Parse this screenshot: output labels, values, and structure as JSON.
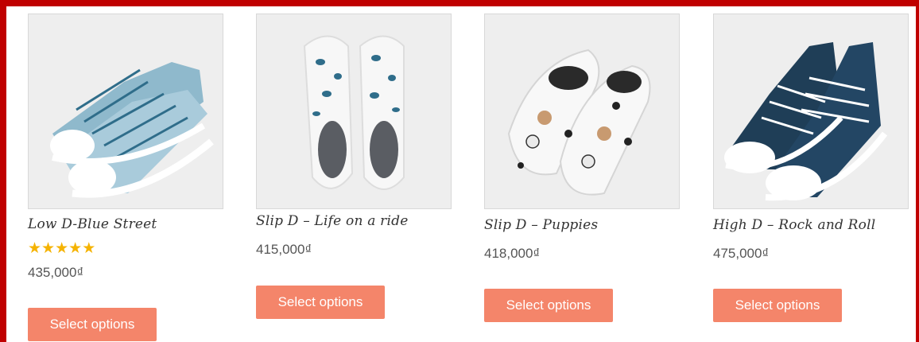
{
  "colors": {
    "frame": "#c00000",
    "button": "#f4856a",
    "star": "#f5b301"
  },
  "products": [
    {
      "name": "Low D-Blue Street",
      "rating_stars": 5,
      "price": "435,000₫",
      "button": "Select options"
    },
    {
      "name": "Slip D – Life on a ride",
      "price": "415,000₫",
      "button": "Select options"
    },
    {
      "name": "Slip D – Puppies",
      "price": "418,000₫",
      "button": "Select options"
    },
    {
      "name": "High D – Rock and Roll",
      "price": "475,000₫",
      "button": "Select options"
    }
  ]
}
